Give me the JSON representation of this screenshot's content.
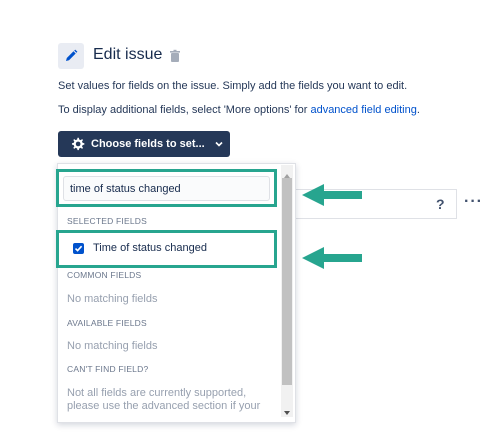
{
  "header": {
    "title": "Edit issue",
    "description_line1": "Set values for fields on the issue. Simply add the fields you want to edit.",
    "description_line2_prefix": "To display additional fields, select 'More options' for ",
    "description_line2_link": "advanced field editing",
    "description_line2_suffix": "."
  },
  "toolbar": {
    "choose_fields_label": "Choose fields to set..."
  },
  "dropdown": {
    "search_value": "time of status changed",
    "sections": {
      "selected": "SELECTED FIELDS",
      "common": "COMMON FIELDS",
      "available": "AVAILABLE FIELDS",
      "cant_find": "CAN'T FIND FIELD?"
    },
    "selected_item": "Time of status changed",
    "selected_item_checked": true,
    "common_empty": "No matching fields",
    "available_empty": "No matching fields",
    "cant_find_note_line1": "Not all fields are currently supported,",
    "cant_find_note_line2": "please use the advanced section if your"
  },
  "field_row": {
    "help_label": "?",
    "more_label": "···"
  },
  "colors": {
    "accent": "#27a58f",
    "primary": "#253858",
    "link": "#0052cc",
    "checkbox": "#0052cc"
  },
  "icons": [
    "pencil-icon",
    "trash-icon",
    "gear-icon",
    "chevron-down-icon",
    "check-icon",
    "arrow-left-icon"
  ]
}
